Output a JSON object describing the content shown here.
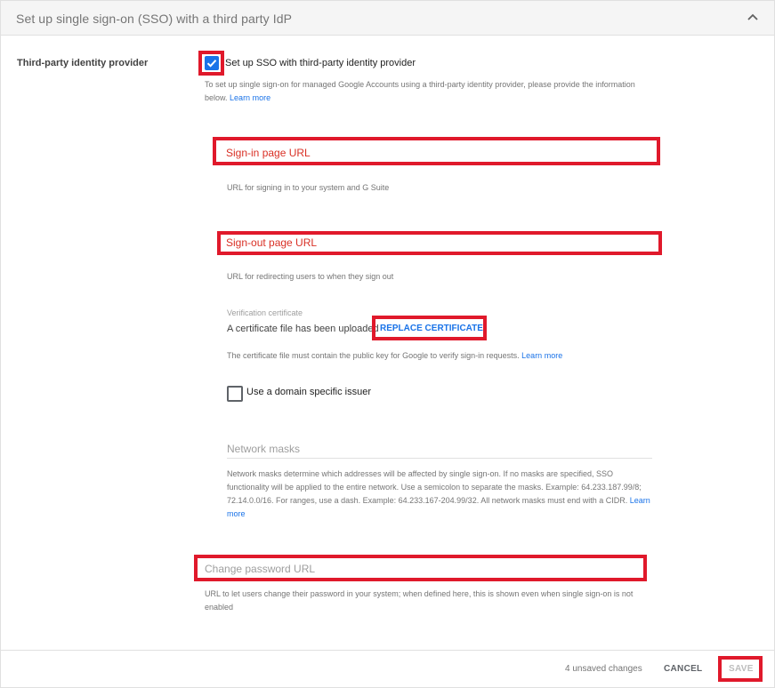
{
  "header": {
    "title": "Set up single sign-on (SSO) with a third party IdP",
    "chevron_icon": "chevron-up-icon"
  },
  "field": {
    "label": "Third-party identity provider"
  },
  "sso_checkbox": {
    "label": "Set up SSO with third-party identity provider",
    "checked": true
  },
  "sso_description": {
    "line1": "To set up single sign-on for managed Google Accounts using a third-party identity provider, please provide the information",
    "line2": "below.",
    "learn_more": "Learn more"
  },
  "signin_url": {
    "label": "Sign-in page URL",
    "helper": "URL for signing in to your system and G Suite"
  },
  "signout_url": {
    "label": "Sign-out page URL",
    "helper": "URL for redirecting users to when they sign out"
  },
  "certificate": {
    "label": "Verification certificate",
    "status": "A certificate file has been uploaded",
    "replace_button": "REPLACE CERTIFICATE",
    "helper": "The certificate file must contain the public key for Google to verify sign-in requests.",
    "learn_more": "Learn more"
  },
  "domain_issuer": {
    "label": "Use a domain specific issuer",
    "checked": false
  },
  "network_masks": {
    "placeholder": "Network masks",
    "helper_line1": "Network masks determine which addresses will be affected by single sign-on. If no masks are specified, SSO",
    "helper_line2": "functionality will be applied to the entire network. Use a semicolon to separate the masks. Example: 64.233.187.99/8;",
    "helper_line3": "72.14.0.0/16. For ranges, use a dash. Example: 64.233.167-204.99/32. All network masks must end with a CIDR.",
    "learn": "Learn",
    "more": "more"
  },
  "change_password": {
    "placeholder": "Change password URL",
    "helper_line1": "URL to let users change their password in your system; when defined here, this is shown even when single sign-on is not",
    "helper_line2": "enabled"
  },
  "footer": {
    "unsaved": "4 unsaved changes",
    "cancel": "CANCEL",
    "save": "SAVE"
  },
  "colors": {
    "accent": "#1a73e8",
    "highlight": "#e0192b",
    "error_text": "#d93025"
  }
}
